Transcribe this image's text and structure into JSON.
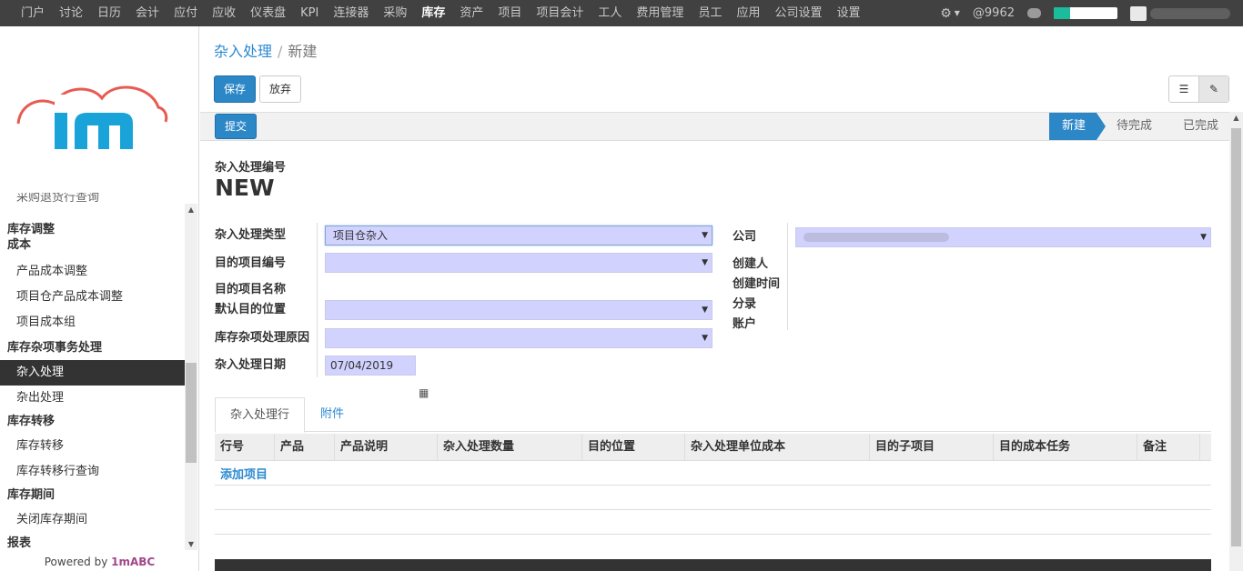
{
  "topbar": {
    "menu": [
      "门户",
      "讨论",
      "日历",
      "会计",
      "应付",
      "应收",
      "仪表盘",
      "KPI",
      "连接器",
      "采购",
      "库存",
      "资产",
      "项目",
      "项目会计",
      "工人",
      "费用管理",
      "员工",
      "应用",
      "公司设置",
      "设置"
    ],
    "active": "库存",
    "counter": "9962",
    "at_sign": "@",
    "progress_fraction": 0.25,
    "progress_color": "#1abc9c"
  },
  "sidebar": {
    "cut_item": "采购退货行查询",
    "sections": [
      {
        "header": "库存调整",
        "items": []
      },
      {
        "header": "成本",
        "items": [
          "产品成本调整",
          "项目仓产品成本调整",
          "项目成本组"
        ]
      },
      {
        "header": "库存杂项事务处理",
        "items": [
          "杂入处理",
          "杂出处理"
        ]
      },
      {
        "header": "库存转移",
        "items": [
          "库存转移",
          "库存转移行查询"
        ]
      },
      {
        "header": "库存期间",
        "items": [
          "关闭库存期间"
        ]
      },
      {
        "header": "报表",
        "items": []
      }
    ],
    "active_item": "杂入处理",
    "powered_prefix": "Powered by",
    "powered_brand": "1mABC"
  },
  "breadcrumb": {
    "parent": "杂入处理",
    "sep": "/",
    "current": "新建"
  },
  "buttons": {
    "save": "保存",
    "discard": "放弃",
    "submit": "提交"
  },
  "stages": [
    "新建",
    "待完成",
    "已完成"
  ],
  "current_stage": "新建",
  "form": {
    "number_label": "杂入处理编号",
    "number_value": "NEW",
    "left_fields": [
      {
        "label": "杂入处理类型",
        "value": "项目仓杂入"
      },
      {
        "label": "目的项目编号",
        "value": ""
      },
      {
        "label": "目的项目名称",
        "value": ""
      },
      {
        "label": "默认目的位置",
        "value": ""
      },
      {
        "label": "库存杂项处理原因",
        "value": ""
      },
      {
        "label": "杂入处理日期",
        "value": "07/04/2019"
      }
    ],
    "right_fields": [
      {
        "label": "公司"
      },
      {
        "label": "创建人"
      },
      {
        "label": "创建时间"
      },
      {
        "label": "分录"
      },
      {
        "label": "账户"
      }
    ]
  },
  "tabs": [
    "杂入处理行",
    "附件"
  ],
  "grid": {
    "columns": [
      "行号",
      "产品",
      "产品说明",
      "杂入处理数量",
      "目的位置",
      "杂入处理单位成本",
      "目的子项目",
      "目的成本任务",
      "备注"
    ],
    "add_item": "添加项目"
  },
  "colors": {
    "primary": "#2c87c7",
    "required_field": "#d2d2ff",
    "topbar": "#414141"
  }
}
